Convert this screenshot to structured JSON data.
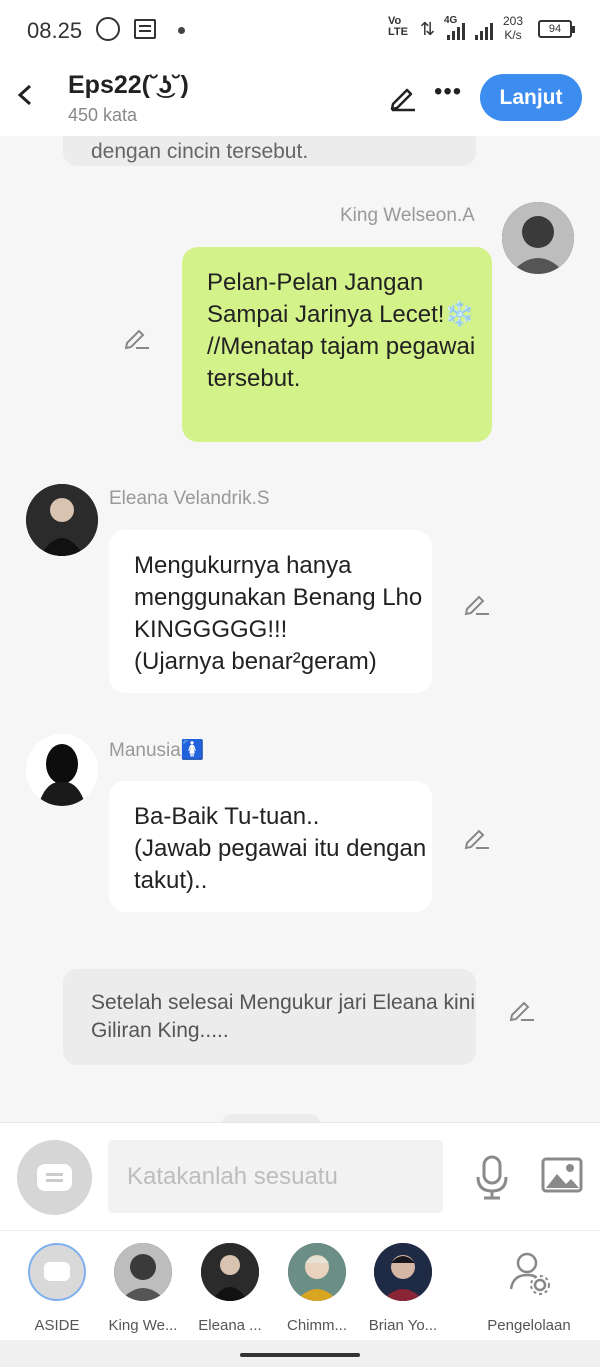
{
  "status_bar": {
    "time": "08.25",
    "network_label": "Vo\nLTE",
    "network_type": "4G",
    "speed": "203\nK/s",
    "battery": "94"
  },
  "header": {
    "back_icon": "chevron-left-icon",
    "title": "Eps22(˘͜ʖ˘)",
    "word_count": "450 kata",
    "next_label": "Lanjut"
  },
  "chat": {
    "top_narration": "dengan cincin tersebut.",
    "messages": [
      {
        "speaker": "King Welseon.A",
        "text": "Pelan-Pelan Jangan Sampai Jarinya Lecet!❄️\n//Menatap tajam pegawai tersebut."
      },
      {
        "speaker": "Eleana Velandrik.S",
        "text": "Mengukurnya hanya menggunakan Benang Lho KINGGGGG!!!\n(Ujarnya benar²geram)"
      },
      {
        "speaker": "Manusia🚺",
        "text": "Ba-Baik Tu-tuan..\n(Jawab pegawai itu dengan takut).."
      }
    ],
    "bottom_narration": "Setelah selesai Mengukur jari Eleana kini Giliran King....."
  },
  "input": {
    "placeholder": "Katakanlah sesuatu"
  },
  "characters": [
    {
      "label": "ASIDE"
    },
    {
      "label": "King We..."
    },
    {
      "label": "Eleana ..."
    },
    {
      "label": "Chimm..."
    },
    {
      "label": "Brian Yo..."
    }
  ],
  "manage_label": "Pengelolaan",
  "colors": {
    "accent": "#3d8cf0",
    "green_bubble": "#d4f28a",
    "background": "#f6f6f6"
  }
}
